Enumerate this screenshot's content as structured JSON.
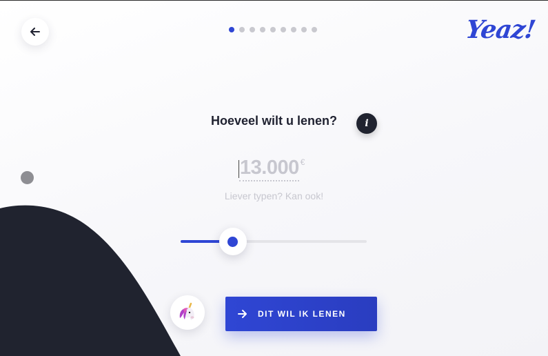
{
  "header": {
    "back_icon": "arrow-left-icon",
    "progress": {
      "total_steps": 9,
      "current_step": 1
    },
    "logo_text": "Yeaz!"
  },
  "main": {
    "question": "Hoeveel wilt u lenen?",
    "info_label": "i",
    "amount": "13.000",
    "currency": "€",
    "hint": "Liever typen? Kan ook!",
    "slider": {
      "value_fraction": 0.28
    },
    "cta_label": "DIT WIL IK LENEN",
    "cta_icon": "arrow-right-icon",
    "mascot_icon": "unicorn-icon"
  },
  "colors": {
    "accent": "#2f46d4",
    "dark": "#20232f",
    "muted": "#c7c7cf"
  }
}
